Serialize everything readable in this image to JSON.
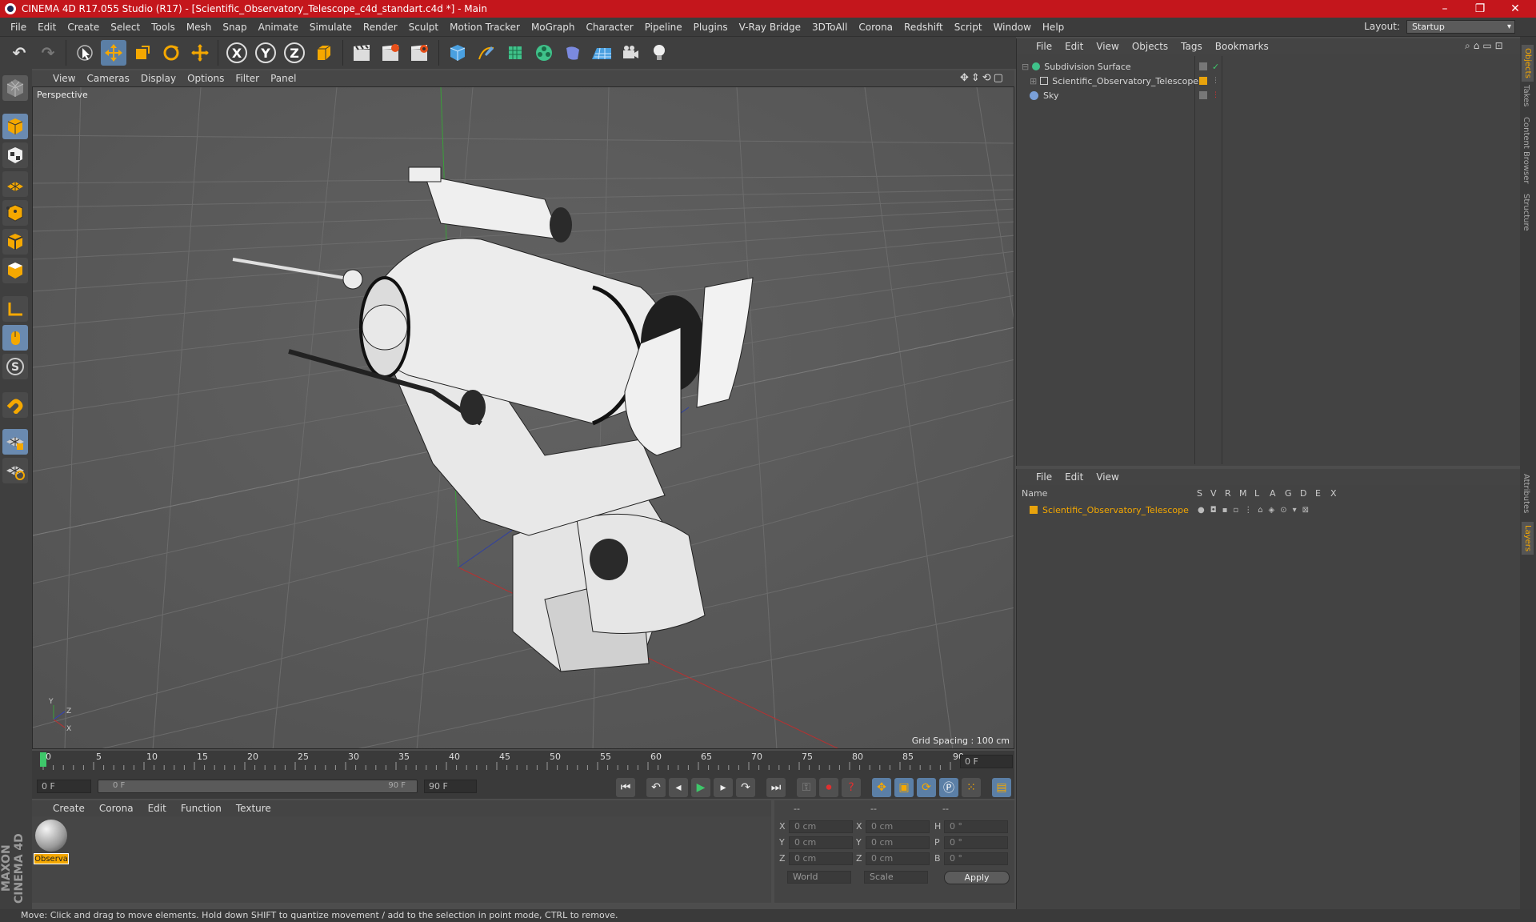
{
  "window": {
    "title": "CINEMA 4D R17.055 Studio (R17) - [Scientific_Observatory_Telescope_c4d_standart.c4d *] - Main",
    "minimize": "–",
    "maximize": "❐",
    "close": "✕"
  },
  "menubar": [
    "File",
    "Edit",
    "Create",
    "Select",
    "Tools",
    "Mesh",
    "Snap",
    "Animate",
    "Simulate",
    "Render",
    "Sculpt",
    "Motion Tracker",
    "MoGraph",
    "Character",
    "Pipeline",
    "Plugins",
    "V-Ray Bridge",
    "3DToAll",
    "Corona",
    "Redshift",
    "Script",
    "Window",
    "Help"
  ],
  "layout": {
    "label": "Layout:",
    "value": "Startup"
  },
  "toolbar": {
    "undo": "↶",
    "redo": "↷",
    "axis_x": "X",
    "axis_y": "Y",
    "axis_z": "Z"
  },
  "viewport": {
    "menu": [
      "View",
      "Cameras",
      "Display",
      "Options",
      "Filter",
      "Panel"
    ],
    "label": "Perspective",
    "grid_spacing": "Grid Spacing : 100 cm",
    "axis_y": "Y",
    "axis_z": "Z",
    "axis_x": "X"
  },
  "timeline": {
    "ticks": [
      "0",
      "5",
      "10",
      "15",
      "20",
      "25",
      "30",
      "35",
      "40",
      "45",
      "50",
      "55",
      "60",
      "65",
      "70",
      "75",
      "80",
      "85",
      "90"
    ],
    "current_frame": "0 F",
    "start_field": "0 F",
    "range_start": "0 F",
    "range_end": "90 F",
    "end_field": "90 F"
  },
  "material_manager": {
    "menu": [
      "Create",
      "Corona",
      "Edit",
      "Function",
      "Texture"
    ],
    "material_name": "Observa"
  },
  "coordinates": {
    "header": [
      "--",
      "--",
      "--"
    ],
    "rows": [
      {
        "a": "X",
        "av": "0 cm",
        "b": "X",
        "bv": "0 cm",
        "c": "H",
        "cv": "0 °"
      },
      {
        "a": "Y",
        "av": "0 cm",
        "b": "Y",
        "bv": "0 cm",
        "c": "P",
        "cv": "0 °"
      },
      {
        "a": "Z",
        "av": "0 cm",
        "b": "Z",
        "bv": "0 cm",
        "c": "B",
        "cv": "0 °"
      }
    ],
    "mode": "World",
    "scale": "Scale",
    "apply": "Apply"
  },
  "object_manager": {
    "menu": [
      "File",
      "Edit",
      "View",
      "Objects",
      "Tags",
      "Bookmarks"
    ],
    "objects": [
      {
        "name": "Subdivision Surface"
      },
      {
        "name": "Scientific_Observatory_Telescope"
      },
      {
        "name": "Sky"
      }
    ]
  },
  "layer_manager": {
    "menu": [
      "File",
      "Edit",
      "View"
    ],
    "columns": [
      "Name",
      "S",
      "V",
      "R",
      "M",
      "L",
      "A",
      "G",
      "D",
      "E",
      "X"
    ],
    "layers": [
      {
        "name": "Scientific_Observatory_Telescope"
      }
    ]
  },
  "right_tabs": [
    "Objects",
    "Takes",
    "Content Browser",
    "Structure",
    "Attributes",
    "Layers"
  ],
  "maxon": "MAXON CINEMA 4D",
  "status": "Move: Click and drag to move elements. Hold down SHIFT to quantize movement / add to the selection in point mode, CTRL to remove.",
  "colors": {
    "titlebar": "#c4161c",
    "selection": "#5b7fa6",
    "layer_color": "#e8a30c"
  }
}
